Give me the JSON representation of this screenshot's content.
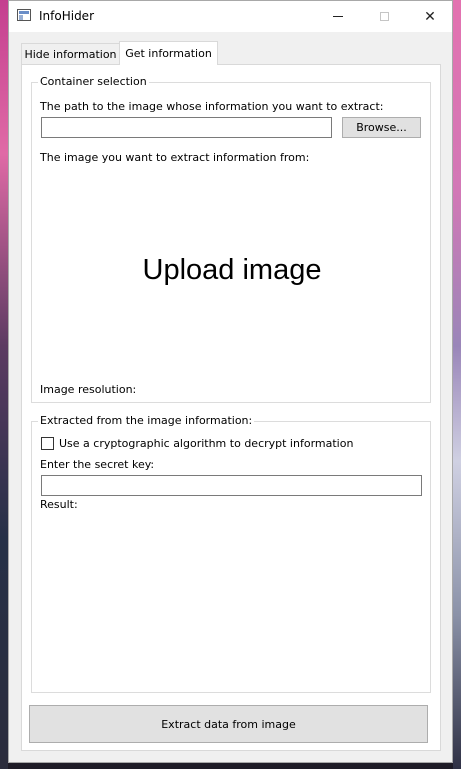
{
  "window": {
    "title": "InfoHider",
    "minimize_icon": "minimize-icon",
    "maximize_icon": "maximize-icon",
    "close_icon": "close-icon",
    "close_glyph": "✕"
  },
  "tabs": [
    {
      "label": "Hide information",
      "active": false
    },
    {
      "label": "Get information",
      "active": true
    }
  ],
  "container_selection": {
    "title": "Container selection",
    "path_label": "The path to the image whose information you want to extract:",
    "path_value": "",
    "browse_label": "Browse...",
    "image_label": "The image you want to extract information from:",
    "upload_text": "Upload image",
    "resolution_label": "Image resolution:"
  },
  "extracted": {
    "title": "Extracted from the image information:",
    "crypto_checkbox_label": "Use a cryptographic algorithm to decrypt information",
    "crypto_checked": false,
    "secret_key_label": "Enter the secret key:",
    "secret_key_value": "",
    "result_label": "Result:"
  },
  "actions": {
    "extract_label": "Extract data from image"
  }
}
